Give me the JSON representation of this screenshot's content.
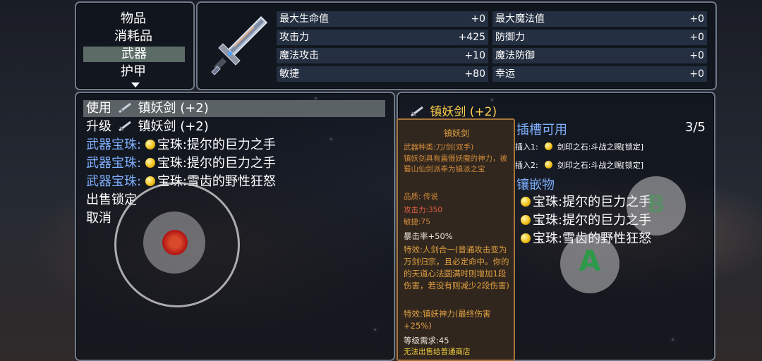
{
  "categories": {
    "items": [
      "物品",
      "消耗品",
      "武器",
      "护甲"
    ],
    "selected": "武器"
  },
  "stats": [
    {
      "label": "最大生命值",
      "value": "+0"
    },
    {
      "label": "最大魔法值",
      "value": "+0"
    },
    {
      "label": "攻击力",
      "value": "+425"
    },
    {
      "label": "防御力",
      "value": "+0"
    },
    {
      "label": "魔法攻击",
      "value": "+10"
    },
    {
      "label": "魔法防御",
      "value": "+0"
    },
    {
      "label": "敏捷",
      "value": "+80"
    },
    {
      "label": "幸运",
      "value": "+0"
    }
  ],
  "actions": {
    "use": {
      "prefix": "使用",
      "item": "镇妖剑 (+2)"
    },
    "upgrade": {
      "prefix": "升级",
      "item": "镇妖剑 (+2)"
    },
    "gems": [
      {
        "slot": "武器宝珠:",
        "gem": "宝珠:提尔的巨力之手"
      },
      {
        "slot": "武器宝珠:",
        "gem": "宝珠:提尔的巨力之手"
      },
      {
        "slot": "武器宝珠:",
        "gem": "宝珠:雪齿的野性狂怒"
      }
    ],
    "sell_lock": "出售锁定",
    "cancel": "取消"
  },
  "detail": {
    "title": "镇妖剑 (+2)",
    "slots_label": "插槽可用",
    "slots_count": "3/5",
    "slot_lines": [
      {
        "label": "插入1:",
        "stone": "剑印之石:斗战之赐[锁定]"
      },
      {
        "label": "插入2:",
        "stone": "剑印之石:斗战之赐[锁定]"
      }
    ],
    "inlay_label": "镶嵌物",
    "inlays": [
      "宝珠:提尔的巨力之手",
      "宝珠:提尔的巨力之手",
      "宝珠:雪齿的野性狂怒"
    ]
  },
  "tooltip": {
    "name": "镇妖剑",
    "type": "武器种类:刀/剑(双手)",
    "desc": "镇妖剑具有震慑妖魔的神力，被蜀山仙剑派奉为镇派之宝",
    "quality": "品质: 传说",
    "attack": "攻击力:350",
    "agility": "敏捷:75",
    "crit": "暴击率+50%",
    "effect1": "特效:人剑合一(普通攻击变为万剑归宗，且必定命中。你的的天道心法圆满时则增加1段伤害，若没有则减少2段伤害)",
    "effect2": "特效:镇妖神力(最终伤害+25%)",
    "level_req": "等级需求:45",
    "sell_note": "无法出售给普通商店"
  },
  "controls": {
    "button_a": "A",
    "button_b": "B"
  },
  "colors": {
    "accent_gold": "#ffcf4a",
    "label_blue": "#7fb0ff",
    "tooltip_orange": "#d08a3a",
    "panel_border": "#6f7a8a"
  }
}
